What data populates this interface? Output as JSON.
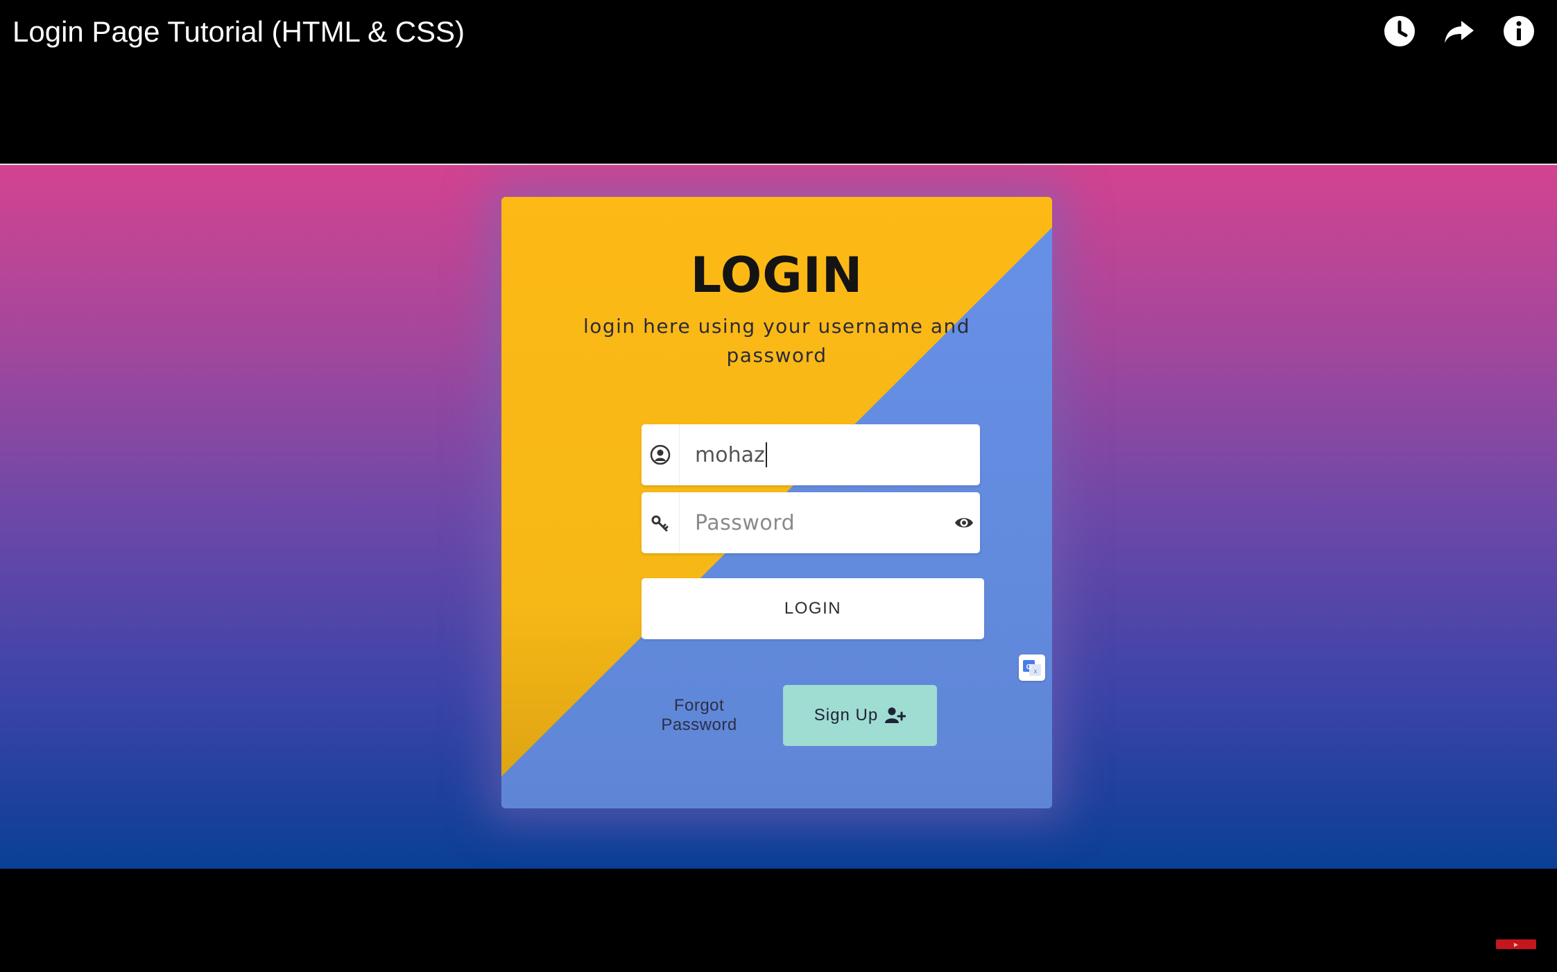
{
  "player": {
    "video_title": "Login Page Tutorial (HTML & CSS)",
    "icons": [
      "watch-later-icon",
      "share-icon",
      "info-icon"
    ]
  },
  "login_card": {
    "title": "LOGIN",
    "subtitle": "login here using your username and password",
    "username": {
      "value": "mohaz",
      "icon": "user-circle-icon"
    },
    "password": {
      "placeholder": "Password",
      "icon": "key-icon",
      "toggle_icon": "eye-icon"
    },
    "login_button": "LOGIN",
    "forgot_password": "Forgot Password",
    "signup_button": "Sign Up",
    "signup_icon": "user-plus-icon",
    "translate_icon": "google-translate-icon"
  },
  "colors": {
    "card_yellow": "#fbb917",
    "card_blue": "#6690e8",
    "signup_button": "#9fdcd1",
    "stage_top": "#d34390",
    "stage_bottom": "#0a3f95"
  }
}
